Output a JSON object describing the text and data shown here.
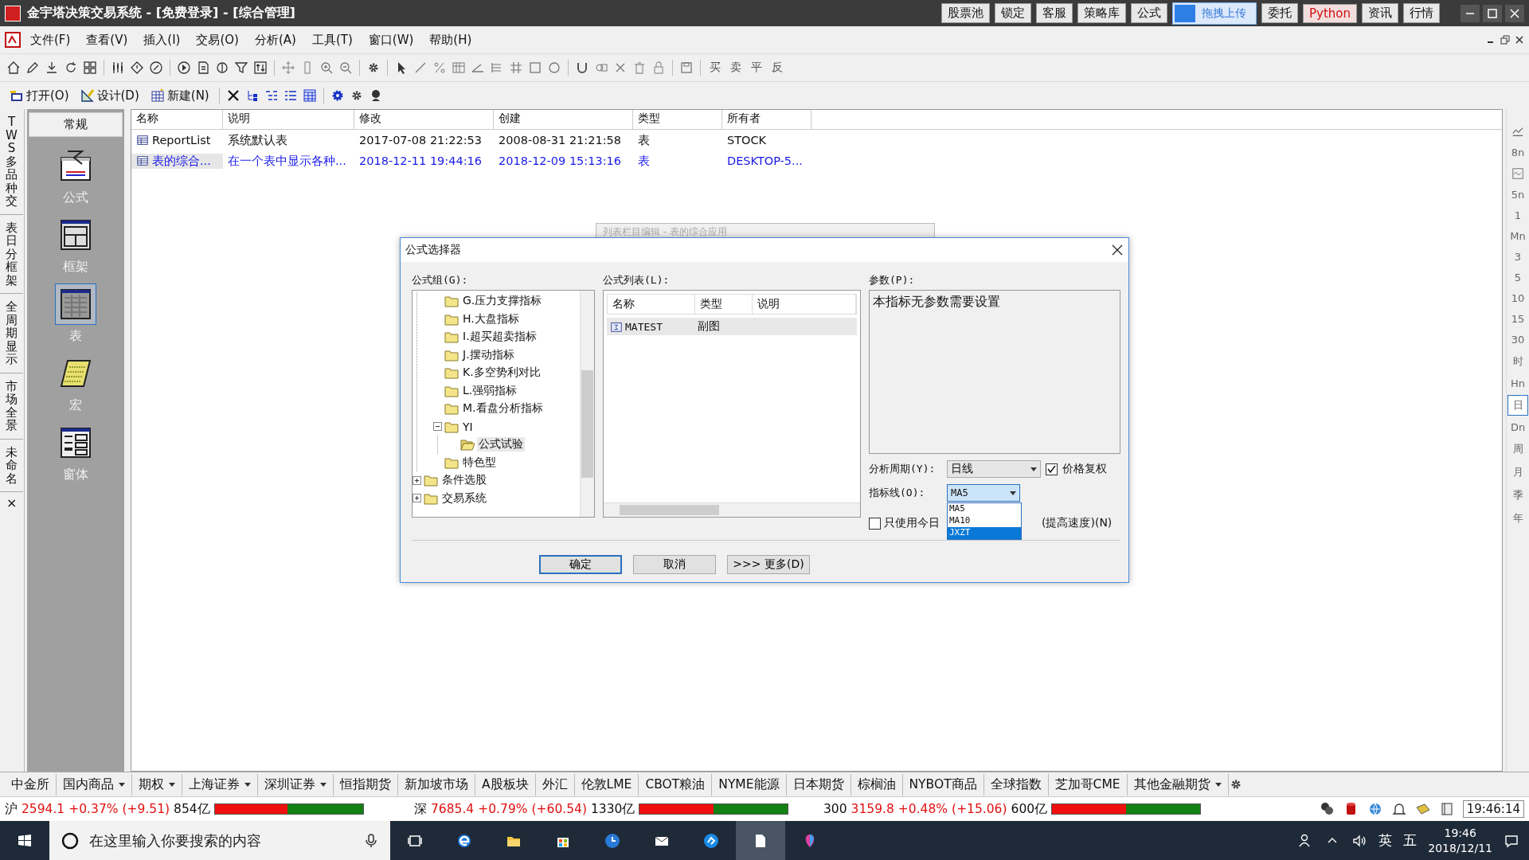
{
  "window": {
    "title": "金宇塔决策交易系统 - [免费登录] - [综合管理]"
  },
  "title_buttons": [
    {
      "label": "股票池",
      "kind": "normal"
    },
    {
      "label": "锁定",
      "kind": "normal"
    },
    {
      "label": "客服",
      "kind": "normal"
    },
    {
      "label": "策略库",
      "kind": "normal"
    },
    {
      "label": "公式",
      "kind": "normal"
    },
    {
      "label": "委托",
      "kind": "normal"
    },
    {
      "label": "Python",
      "kind": "highlight"
    },
    {
      "label": "资讯",
      "kind": "normal"
    },
    {
      "label": "行情",
      "kind": "normal"
    }
  ],
  "upload_badge": {
    "label": "拖拽上传"
  },
  "menu": [
    "文件(F)",
    "查看(V)",
    "插入(I)",
    "交易(O)",
    "分析(A)",
    "工具(T)",
    "窗口(W)",
    "帮助(H)"
  ],
  "trade_tools": [
    "买",
    "卖",
    "平",
    "反"
  ],
  "toolbar2": [
    {
      "label": "打开(O)",
      "kind": "open"
    },
    {
      "label": "设计(D)",
      "kind": "design"
    },
    {
      "label": "新建(N)",
      "kind": "new"
    }
  ],
  "side_tabs": [
    {
      "label": "TWS多品种交"
    },
    {
      "label": "表日分框架"
    },
    {
      "label": "全周期显示"
    },
    {
      "label": "市场全景"
    },
    {
      "label": "未命名"
    }
  ],
  "side_tabs_close": "×",
  "category_panel": {
    "header": "常规",
    "items": [
      {
        "label": "公式",
        "kind": "formula",
        "selected": false
      },
      {
        "label": "框架",
        "kind": "frame",
        "selected": false
      },
      {
        "label": "表",
        "kind": "table",
        "selected": true
      },
      {
        "label": "宏",
        "kind": "macro",
        "selected": false
      },
      {
        "label": "窗体",
        "kind": "form",
        "selected": false
      }
    ]
  },
  "table": {
    "columns": [
      "名称",
      "说明",
      "修改",
      "创建",
      "类型",
      "所有者"
    ],
    "rows": [
      {
        "cells": [
          "ReportList",
          "系统默认表",
          "2017-07-08 21:22:53",
          "2008-08-31 21:21:58",
          "表",
          "STOCK"
        ],
        "selected": false
      },
      {
        "cells": [
          "表的综合...",
          "在一个表中显示各种...",
          "2018-12-11 19:44:16",
          "2018-12-09 15:13:16",
          "表",
          "DESKTOP-5..."
        ],
        "selected": true
      }
    ]
  },
  "period_bar": [
    {
      "kind": "line-chart",
      "selected": false
    },
    {
      "kind": "text",
      "label": "8n",
      "selected": false
    },
    {
      "kind": "wave",
      "selected": false
    },
    {
      "kind": "text",
      "label": "5n",
      "selected": false
    },
    {
      "kind": "text",
      "label": "1",
      "selected": false
    },
    {
      "kind": "text",
      "label": "Mn",
      "selected": false
    },
    {
      "kind": "text",
      "label": "3",
      "selected": false
    },
    {
      "kind": "text",
      "label": "5",
      "selected": false
    },
    {
      "kind": "text",
      "label": "10",
      "selected": false
    },
    {
      "kind": "text",
      "label": "15",
      "selected": false
    },
    {
      "kind": "text",
      "label": "30",
      "selected": false
    },
    {
      "kind": "text",
      "label": "时",
      "selected": false
    },
    {
      "kind": "text",
      "label": "Hn",
      "selected": false
    },
    {
      "kind": "text",
      "label": "日",
      "selected": true
    },
    {
      "kind": "text",
      "label": "Dn",
      "selected": false
    },
    {
      "kind": "text",
      "label": "周",
      "selected": false
    },
    {
      "kind": "text",
      "label": "月",
      "selected": false
    },
    {
      "kind": "text",
      "label": "季",
      "selected": false
    },
    {
      "kind": "text",
      "label": "年",
      "selected": false
    }
  ],
  "back_window": {
    "title": "列表栏目编辑 - 表的综合应用"
  },
  "dialog": {
    "title": "公式选择器",
    "group_label": "公式组(G):",
    "tree": [
      {
        "children": [
          {
            "label": "G.压力支撑指标",
            "selected": false
          },
          {
            "label": "H.大盘指标",
            "selected": false
          },
          {
            "label": "I.超买超卖指标",
            "selected": false
          },
          {
            "label": "J.摆动指标",
            "selected": false
          },
          {
            "label": "K.多空势利对比",
            "selected": false
          },
          {
            "label": "L.强弱指标",
            "selected": false
          },
          {
            "label": "M.看盘分析指标",
            "selected": false
          },
          {
            "label": "YI",
            "selected": false,
            "expanded": true,
            "children": [
              {
                "label": "公式试验",
                "selected": true
              }
            ]
          },
          {
            "label": "特色型",
            "selected": false
          }
        ]
      },
      {
        "label": "条件选股",
        "selected": false,
        "expanded": false
      },
      {
        "label": "交易系统",
        "selected": false,
        "expanded": false
      }
    ],
    "list_label": "公式列表(L):",
    "list_columns": [
      "名称",
      "类型",
      "说明"
    ],
    "list_rows": [
      {
        "cells": [
          "MATEST",
          "副图"
        ],
        "selected": true
      }
    ],
    "params_label": "参数(P):",
    "params_text": "本指标无参数需要设置",
    "period_label": "分析周期(Y):",
    "period_value": "日线",
    "adjust": {
      "label": "价格复权",
      "checked": true
    },
    "line_label": "指标线(O):",
    "line_value": "MA5",
    "line_options": [
      {
        "label": "MA5",
        "selected": false
      },
      {
        "label": "MA10",
        "selected": false
      },
      {
        "label": "JXZT",
        "selected": true
      }
    ],
    "today_only": {
      "label_start": "只使用今日",
      "label_end": "(提高速度)(N)",
      "checked": false
    },
    "buttons": [
      {
        "label": "确定",
        "kind": "default"
      },
      {
        "label": "取消",
        "kind": "normal"
      },
      {
        "label": ">>> 更多(D)",
        "kind": "normal"
      }
    ]
  },
  "market_tabs": [
    {
      "label": "中金所",
      "dropdown": false
    },
    {
      "label": "国内商品",
      "dropdown": true
    },
    {
      "label": "期权",
      "dropdown": true
    },
    {
      "label": "上海证券",
      "dropdown": true
    },
    {
      "label": "深圳证券",
      "dropdown": true
    },
    {
      "label": "恒指期货",
      "dropdown": false
    },
    {
      "label": "新加坡市场",
      "dropdown": false
    },
    {
      "label": "A股板块",
      "dropdown": false
    },
    {
      "label": "外汇",
      "dropdown": false
    },
    {
      "label": "伦敦LME",
      "dropdown": false
    },
    {
      "label": "CBOT粮油",
      "dropdown": false
    },
    {
      "label": "NYME能源",
      "dropdown": false
    },
    {
      "label": "日本期货",
      "dropdown": false
    },
    {
      "label": "棕榈油",
      "dropdown": false
    },
    {
      "label": "NYBOT商品",
      "dropdown": false
    },
    {
      "label": "全球指数",
      "dropdown": false
    },
    {
      "label": "芝加哥CME",
      "dropdown": false
    },
    {
      "label": "其他金融期货",
      "dropdown": true
    }
  ],
  "quotes": [
    {
      "market": "沪",
      "price": "2594.1",
      "change_pct": "+0.37%",
      "change": "(+9.51)",
      "volume": "854亿",
      "level": 0.49
    },
    {
      "market": "深",
      "price": "7685.4",
      "change_pct": "+0.79%",
      "change": "(+60.54)",
      "volume": "1330亿",
      "level": 0.5
    },
    {
      "market": "300",
      "price": "3159.8",
      "change_pct": "+0.48%",
      "change": "(+15.06)",
      "volume": "600亿",
      "level": 0.5
    }
  ],
  "clock": "19:46:14",
  "taskbar": {
    "search_placeholder": "在这里输入你要搜索的内容",
    "ime_lang": "英",
    "ime_mode": "五",
    "time": "19:46",
    "date": "2018/12/11"
  }
}
